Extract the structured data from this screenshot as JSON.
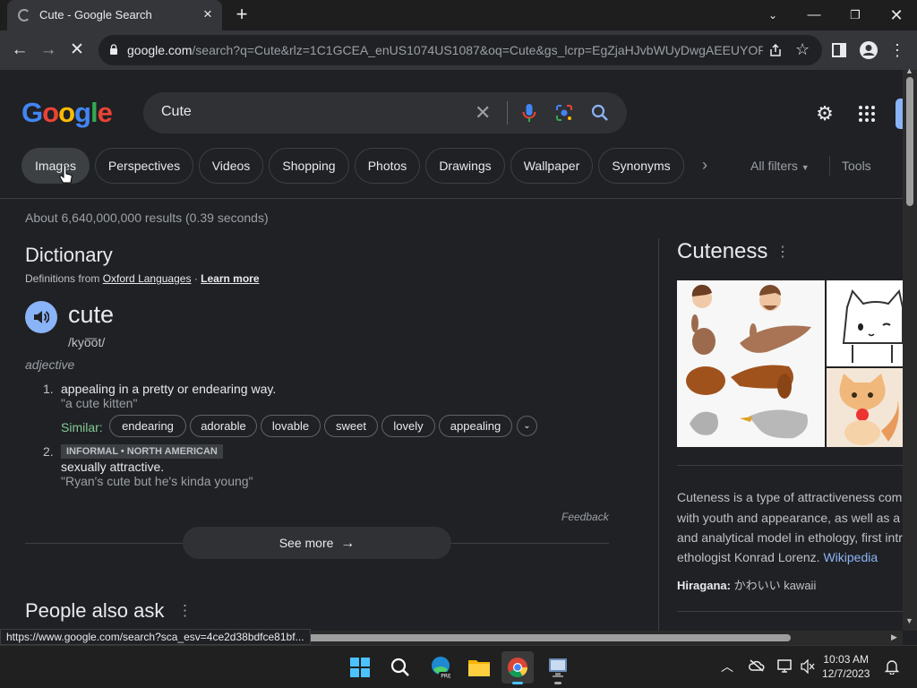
{
  "browser": {
    "tab_title": "Cute - Google Search",
    "url_host": "google.com",
    "url_rest": "/search?q=Cute&rlz=1C1GCEA_enUS1074US1087&oq=Cute&gs_lcrp=EgZjaHJvbWUyDwgAEEUYORi...",
    "status_url": "https://www.google.com/search?sca_esv=4ce2d38bdfce81bf..."
  },
  "search": {
    "logo": "Google",
    "query": "Cute"
  },
  "filters": {
    "chips": [
      "Images",
      "Perspectives",
      "Videos",
      "Shopping",
      "Photos",
      "Drawings",
      "Wallpaper",
      "Synonyms"
    ],
    "all_filters": "All filters",
    "tools": "Tools"
  },
  "results": {
    "stats": "About 6,640,000,000 results (0.39 seconds)"
  },
  "dictionary": {
    "title": "Dictionary",
    "source_prefix": "Definitions from",
    "source_name": "Oxford Languages",
    "learn_more": "Learn more",
    "word": "cute",
    "pronunciation": "/kyo͞ot/",
    "part_of_speech": "adjective",
    "def1_num": "1.",
    "def1_text": "appealing in a pretty or endearing way.",
    "def1_example": "\"a cute kitten\"",
    "similar_label": "Similar:",
    "similar": [
      "endearing",
      "adorable",
      "lovable",
      "sweet",
      "lovely",
      "appealing"
    ],
    "def2_num": "2.",
    "def2_register": "INFORMAL • NORTH AMERICAN",
    "def2_text": "sexually attractive.",
    "def2_example": "\"Ryan's cute but he's kinda young\"",
    "feedback": "Feedback",
    "see_more": "See more"
  },
  "people_also_ask": {
    "title": "People also ask"
  },
  "knowledge_panel": {
    "title": "Cuteness",
    "lines": [
      "Cuteness is a type of attractiveness com",
      "with youth and appearance, as well as a",
      "and analytical model in ethology, first intr",
      "ethologist Konrad Lorenz."
    ],
    "wiki_link": "Wikipedia",
    "hiragana_label": "Hiragana:",
    "hiragana_value": "かわいい kawaii"
  },
  "taskbar": {
    "time": "10:03 AM",
    "date": "12/7/2023"
  },
  "colors": {
    "background": "#202124",
    "link": "#8ab4f8",
    "similar_green": "#81c995"
  }
}
